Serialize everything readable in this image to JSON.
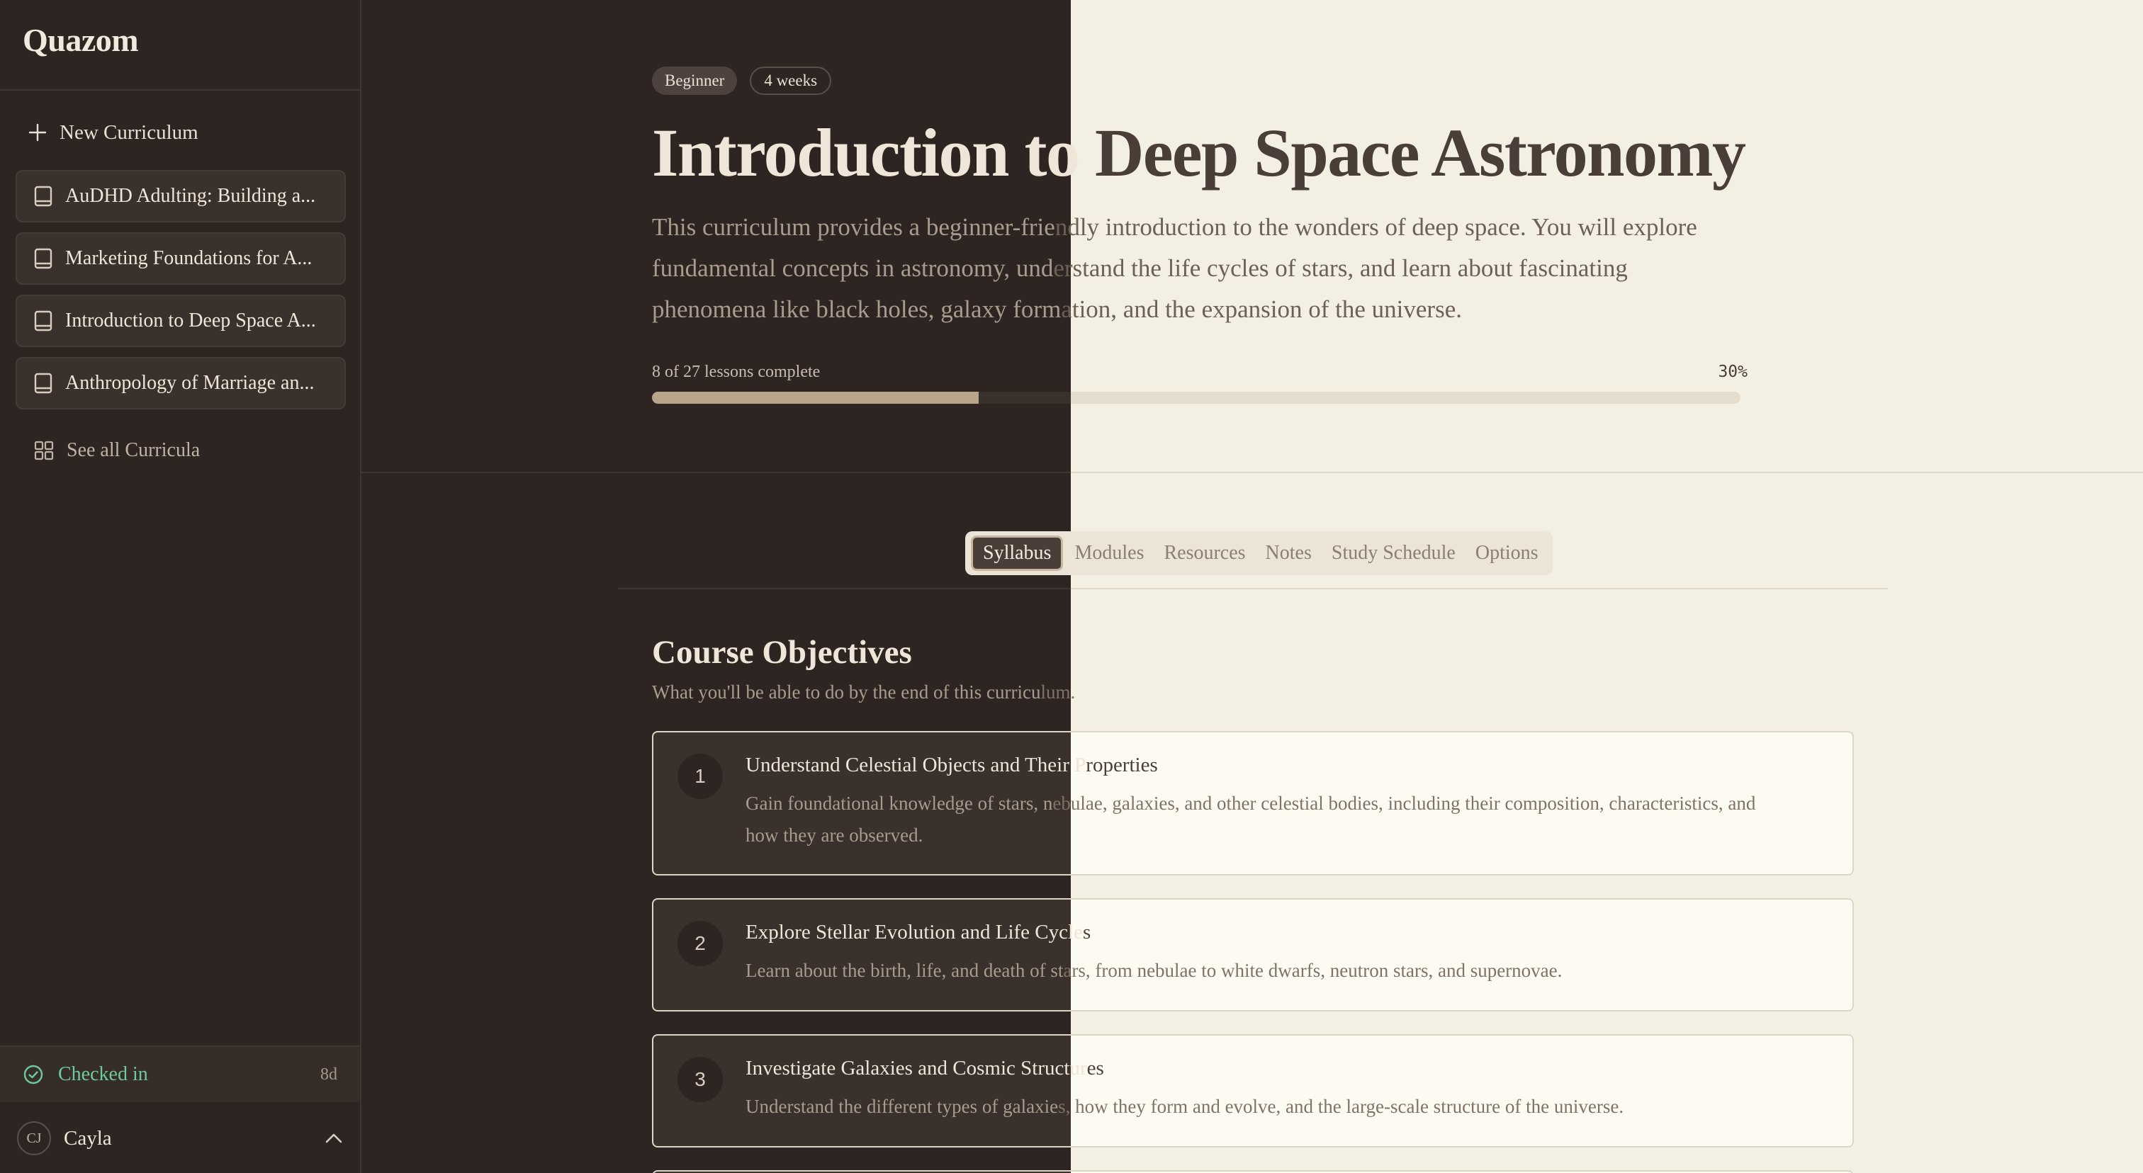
{
  "sidebar": {
    "brand": "Quazom",
    "new_curriculum_label": "New Curriculum",
    "curricula": [
      {
        "label": "AuDHD Adulting: Building a..."
      },
      {
        "label": "Marketing Foundations for A..."
      },
      {
        "label": "Introduction to Deep Space A..."
      },
      {
        "label": "Anthropology of Marriage an..."
      }
    ],
    "see_all_label": "See all Curricula",
    "checked_in": {
      "label": "Checked in",
      "days": "8d"
    },
    "user": {
      "initials": "CJ",
      "name": "Cayla"
    }
  },
  "course": {
    "badges": [
      "Beginner",
      "4 weeks"
    ],
    "title_part1": "Introduction to ",
    "title_part2": "Deep Space Astronomy",
    "description_parts": [
      "This curriculum provides a beginner-frie",
      "ndly introduction to the wonders of deep space. You will explore",
      "fundamental concepts in astronomy, und",
      "erstand the life cycles of stars, and learn about fascinating",
      "phenomena like black holes, galaxy form",
      "ation, and the expansion of the universe."
    ],
    "progress_label": "8 of 27 lessons complete",
    "progress_pct": "30%",
    "progress_value": 0.3
  },
  "tabs": [
    {
      "label": "Syllabus",
      "active": true
    },
    {
      "label": "Modules",
      "active": false
    },
    {
      "label": "Resources",
      "active": false
    },
    {
      "label": "Notes",
      "active": false
    },
    {
      "label": "Study Schedule",
      "active": false
    },
    {
      "label": "Options",
      "active": false
    }
  ],
  "objectives": {
    "title": "Course Objectives",
    "subtitle_part1": "What you'll be able to do by the end of this curricu",
    "subtitle_part2": "lum.",
    "items": [
      {
        "number": "1",
        "title_part1": "Understand Celestial Objects and Their P",
        "title_part2": "roperties",
        "desc_part1": "Gain foundational knowledge of stars, n",
        "desc_part2": "ebulae, galaxies, and other celestial bodies, including their composition, characteristics, and",
        "desc_line2": "how they are observed."
      },
      {
        "number": "2",
        "title_part1": "Explore Stellar Evolution and Life Cycle",
        "title_part2": "s",
        "desc_part1": "Learn about the birth, life, and death of st",
        "desc_part2": "ars, from nebulae to white dwarfs, neutron stars, and supernovae.",
        "desc_line2": ""
      },
      {
        "number": "3",
        "title_part1": "Investigate Galaxies and Cosmic Structur",
        "title_part2": "es",
        "desc_part1": "Understand the different types of galaxie",
        "desc_part2": "s, how they form and evolve, and the large-scale structure of the universe.",
        "desc_line2": ""
      }
    ]
  },
  "colors": {
    "sidebar_bg": "#2e2522",
    "main_bg": "#f4efe3",
    "accent": "#b9a58b",
    "checked_in": "#6ccb9b"
  },
  "icons": {
    "new": "plus-icon",
    "curriculum": "book-icon",
    "see_all": "grid-icon",
    "checked": "check-circle-icon",
    "user_menu": "chevron-up-icon"
  }
}
